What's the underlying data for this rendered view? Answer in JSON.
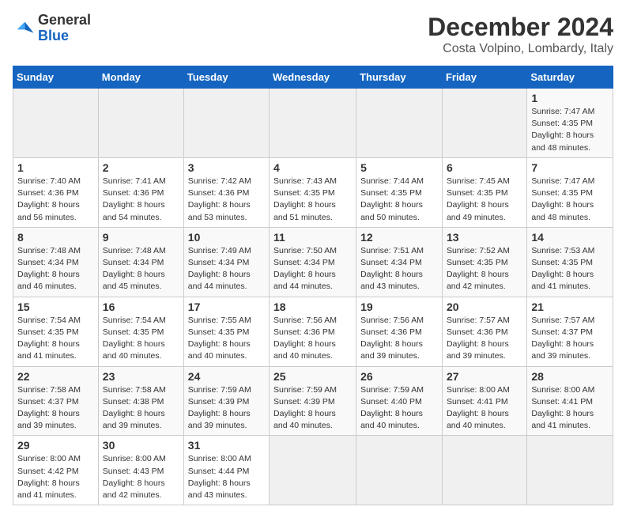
{
  "header": {
    "logo_general": "General",
    "logo_blue": "Blue",
    "title": "December 2024",
    "location": "Costa Volpino, Lombardy, Italy"
  },
  "calendar": {
    "days_of_week": [
      "Sunday",
      "Monday",
      "Tuesday",
      "Wednesday",
      "Thursday",
      "Friday",
      "Saturday"
    ],
    "weeks": [
      [
        null,
        null,
        null,
        null,
        null,
        null,
        {
          "day": 1,
          "sunrise": "7:47 AM",
          "sunset": "4:35 PM",
          "daylight": "8 hours and 48 minutes"
        }
      ],
      [
        {
          "day": 1,
          "sunrise": "7:40 AM",
          "sunset": "4:36 PM",
          "daylight": "8 hours and 56 minutes"
        },
        {
          "day": 2,
          "sunrise": "7:41 AM",
          "sunset": "4:36 PM",
          "daylight": "8 hours and 54 minutes"
        },
        {
          "day": 3,
          "sunrise": "7:42 AM",
          "sunset": "4:36 PM",
          "daylight": "8 hours and 53 minutes"
        },
        {
          "day": 4,
          "sunrise": "7:43 AM",
          "sunset": "4:35 PM",
          "daylight": "8 hours and 51 minutes"
        },
        {
          "day": 5,
          "sunrise": "7:44 AM",
          "sunset": "4:35 PM",
          "daylight": "8 hours and 50 minutes"
        },
        {
          "day": 6,
          "sunrise": "7:45 AM",
          "sunset": "4:35 PM",
          "daylight": "8 hours and 49 minutes"
        },
        {
          "day": 7,
          "sunrise": "7:47 AM",
          "sunset": "4:35 PM",
          "daylight": "8 hours and 48 minutes"
        }
      ],
      [
        {
          "day": 8,
          "sunrise": "7:48 AM",
          "sunset": "4:34 PM",
          "daylight": "8 hours and 46 minutes"
        },
        {
          "day": 9,
          "sunrise": "7:48 AM",
          "sunset": "4:34 PM",
          "daylight": "8 hours and 45 minutes"
        },
        {
          "day": 10,
          "sunrise": "7:49 AM",
          "sunset": "4:34 PM",
          "daylight": "8 hours and 44 minutes"
        },
        {
          "day": 11,
          "sunrise": "7:50 AM",
          "sunset": "4:34 PM",
          "daylight": "8 hours and 44 minutes"
        },
        {
          "day": 12,
          "sunrise": "7:51 AM",
          "sunset": "4:34 PM",
          "daylight": "8 hours and 43 minutes"
        },
        {
          "day": 13,
          "sunrise": "7:52 AM",
          "sunset": "4:35 PM",
          "daylight": "8 hours and 42 minutes"
        },
        {
          "day": 14,
          "sunrise": "7:53 AM",
          "sunset": "4:35 PM",
          "daylight": "8 hours and 41 minutes"
        }
      ],
      [
        {
          "day": 15,
          "sunrise": "7:54 AM",
          "sunset": "4:35 PM",
          "daylight": "8 hours and 41 minutes"
        },
        {
          "day": 16,
          "sunrise": "7:54 AM",
          "sunset": "4:35 PM",
          "daylight": "8 hours and 40 minutes"
        },
        {
          "day": 17,
          "sunrise": "7:55 AM",
          "sunset": "4:35 PM",
          "daylight": "8 hours and 40 minutes"
        },
        {
          "day": 18,
          "sunrise": "7:56 AM",
          "sunset": "4:36 PM",
          "daylight": "8 hours and 40 minutes"
        },
        {
          "day": 19,
          "sunrise": "7:56 AM",
          "sunset": "4:36 PM",
          "daylight": "8 hours and 39 minutes"
        },
        {
          "day": 20,
          "sunrise": "7:57 AM",
          "sunset": "4:36 PM",
          "daylight": "8 hours and 39 minutes"
        },
        {
          "day": 21,
          "sunrise": "7:57 AM",
          "sunset": "4:37 PM",
          "daylight": "8 hours and 39 minutes"
        }
      ],
      [
        {
          "day": 22,
          "sunrise": "7:58 AM",
          "sunset": "4:37 PM",
          "daylight": "8 hours and 39 minutes"
        },
        {
          "day": 23,
          "sunrise": "7:58 AM",
          "sunset": "4:38 PM",
          "daylight": "8 hours and 39 minutes"
        },
        {
          "day": 24,
          "sunrise": "7:59 AM",
          "sunset": "4:39 PM",
          "daylight": "8 hours and 39 minutes"
        },
        {
          "day": 25,
          "sunrise": "7:59 AM",
          "sunset": "4:39 PM",
          "daylight": "8 hours and 40 minutes"
        },
        {
          "day": 26,
          "sunrise": "7:59 AM",
          "sunset": "4:40 PM",
          "daylight": "8 hours and 40 minutes"
        },
        {
          "day": 27,
          "sunrise": "8:00 AM",
          "sunset": "4:41 PM",
          "daylight": "8 hours and 40 minutes"
        },
        {
          "day": 28,
          "sunrise": "8:00 AM",
          "sunset": "4:41 PM",
          "daylight": "8 hours and 41 minutes"
        }
      ],
      [
        {
          "day": 29,
          "sunrise": "8:00 AM",
          "sunset": "4:42 PM",
          "daylight": "8 hours and 41 minutes"
        },
        {
          "day": 30,
          "sunrise": "8:00 AM",
          "sunset": "4:43 PM",
          "daylight": "8 hours and 42 minutes"
        },
        {
          "day": 31,
          "sunrise": "8:00 AM",
          "sunset": "4:44 PM",
          "daylight": "8 hours and 43 minutes"
        },
        null,
        null,
        null,
        null
      ]
    ],
    "labels": {
      "sunrise": "Sunrise:",
      "sunset": "Sunset:",
      "daylight": "Daylight:"
    }
  }
}
